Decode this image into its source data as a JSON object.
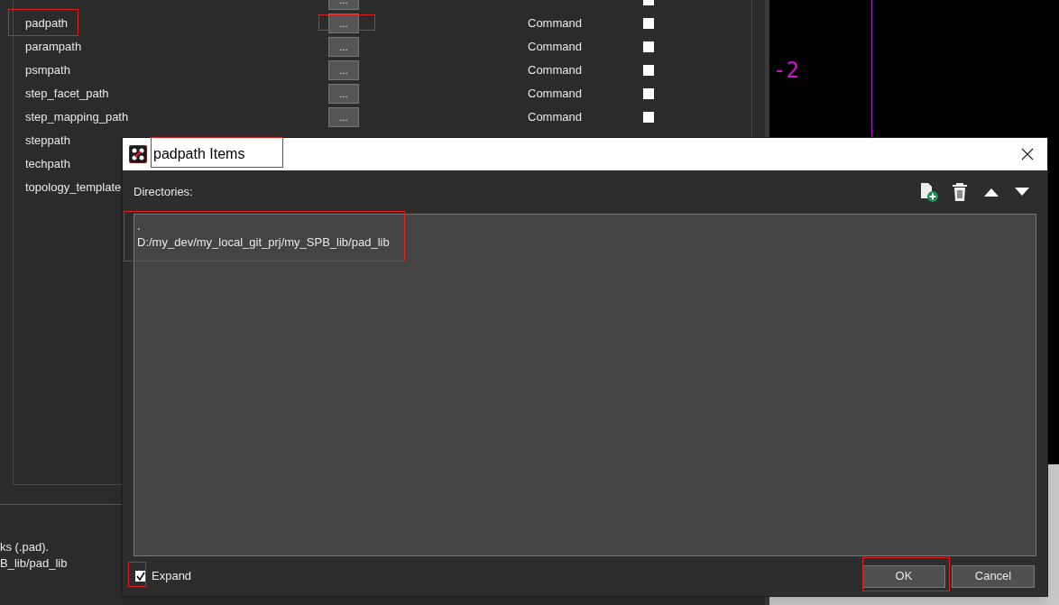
{
  "settings_list": {
    "rows": [
      {
        "button": "...",
        "checked": false
      },
      {
        "name": "padpath",
        "button": "...",
        "type": "Command",
        "checked": false
      },
      {
        "name": "parampath",
        "button": "...",
        "type": "Command",
        "checked": false
      },
      {
        "name": "psmpath",
        "button": "...",
        "type": "Command",
        "checked": false
      },
      {
        "name": "step_facet_path",
        "button": "...",
        "type": "Command",
        "checked": false
      },
      {
        "name": "step_mapping_path",
        "button": "...",
        "type": "Command",
        "checked": false
      },
      {
        "name": "steppath"
      },
      {
        "name": "techpath"
      },
      {
        "name": "topology_template"
      }
    ]
  },
  "description": {
    "lines": [
      "ks (.pad).",
      "B_lib/pad_lib"
    ]
  },
  "canvas": {
    "label": "-2"
  },
  "dialog": {
    "title": "padpath Items",
    "label": "Directories:",
    "directories": [
      ".",
      "D:/my_dev/my_local_git_prj/my_SPB_lib/pad_lib"
    ],
    "expand": {
      "label": "Expand",
      "checked": true
    },
    "buttons": [
      "OK",
      "Cancel"
    ]
  }
}
